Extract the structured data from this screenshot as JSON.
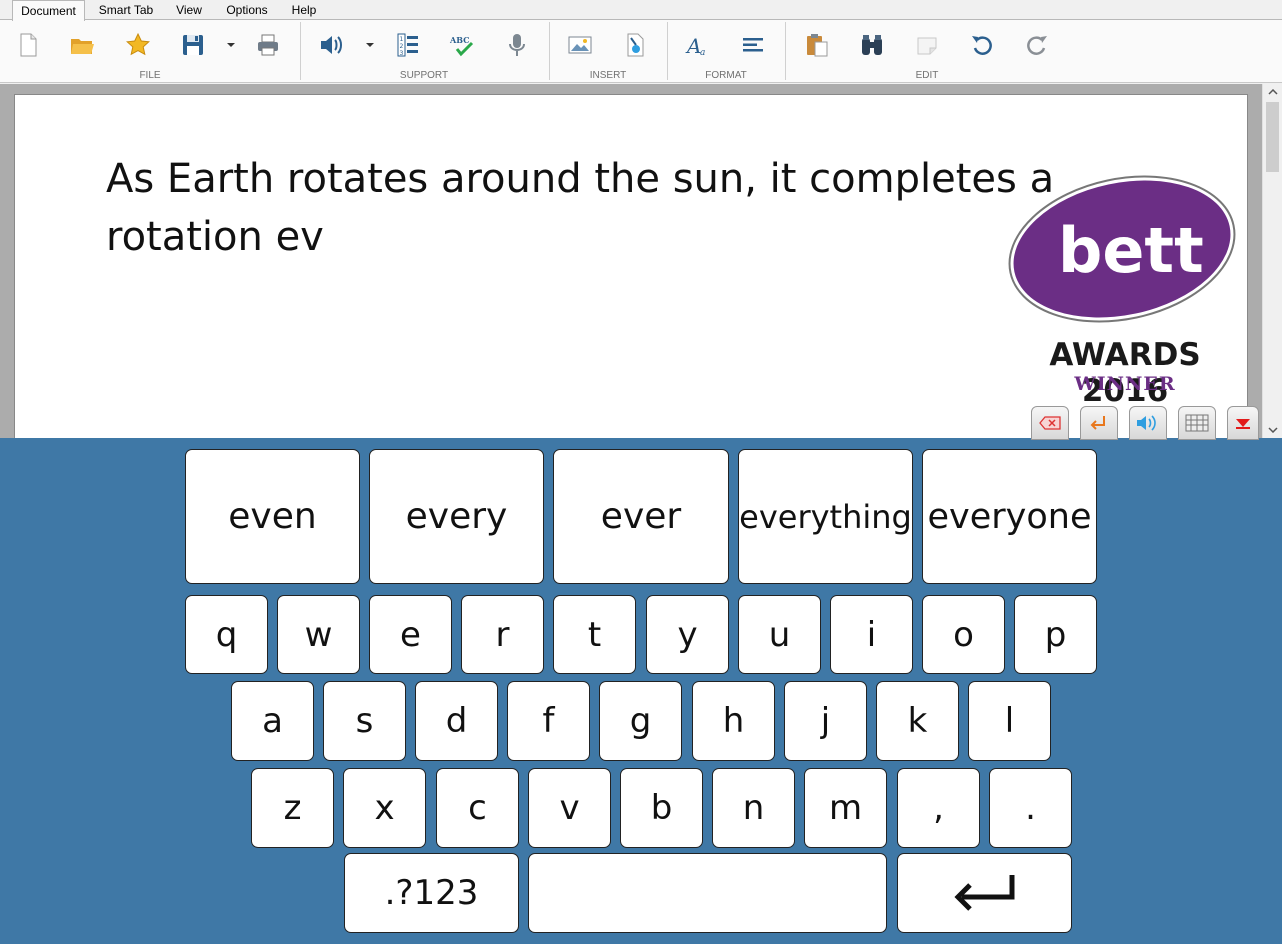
{
  "tabs": [
    {
      "label": "Document",
      "active": true
    },
    {
      "label": "Smart Tab",
      "active": false
    },
    {
      "label": "View",
      "active": false
    },
    {
      "label": "Options",
      "active": false
    },
    {
      "label": "Help",
      "active": false
    }
  ],
  "ribbon": {
    "groups": [
      {
        "label": "FILE",
        "buttons": [
          "new-document-icon",
          "open-folder-icon",
          "favourites-star-icon",
          "save-disk-icon",
          "print-icon"
        ]
      },
      {
        "label": "SUPPORT",
        "buttons": [
          "speak-speaker-icon",
          "word-list-icon",
          "spellcheck-icon",
          "microphone-icon"
        ]
      },
      {
        "label": "INSERT",
        "buttons": [
          "insert-image-icon",
          "insert-file-icon"
        ]
      },
      {
        "label": "FORMAT",
        "buttons": [
          "font-style-icon",
          "align-left-icon"
        ]
      },
      {
        "label": "EDIT",
        "buttons": [
          "paste-clipboard-icon",
          "find-binoculars-icon",
          "note-icon",
          "undo-icon",
          "redo-icon"
        ]
      }
    ]
  },
  "document": {
    "text": "As Earth rotates around the sun, it completes a rotation ev"
  },
  "logo": {
    "brand": "bett",
    "awards": "AWARDS 2016",
    "winner": "WINNER",
    "color": "#6b2e85"
  },
  "keyboard_controls": [
    "backspace-icon",
    "enter-arrow-icon",
    "speak-keyboard-icon",
    "keyboard-grid-icon",
    "hide-keyboard-icon"
  ],
  "keyboard": {
    "predictions": [
      "even",
      "every",
      "ever",
      "everything",
      "everyone"
    ],
    "row1": [
      "q",
      "w",
      "e",
      "r",
      "t",
      "y",
      "u",
      "i",
      "o",
      "p"
    ],
    "row2": [
      "a",
      "s",
      "d",
      "f",
      "g",
      "h",
      "j",
      "k",
      "l"
    ],
    "row3": [
      "z",
      "x",
      "c",
      "v",
      "b",
      "n",
      "m",
      ",",
      "."
    ],
    "symbols_label": ".?123",
    "background_color": "#3f78a6"
  }
}
